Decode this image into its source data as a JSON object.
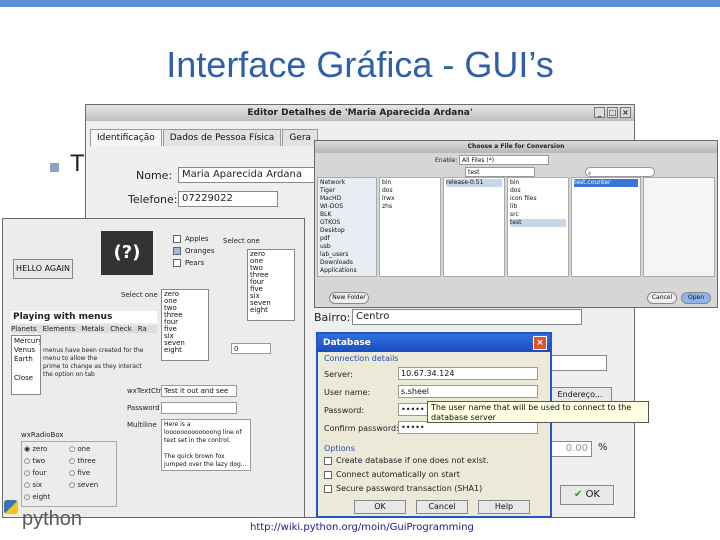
{
  "slide": {
    "title": "Interface Gráfica - GUI’s",
    "bullet": "T"
  },
  "editor": {
    "title": "Editor Detalhes de 'Maria Aparecida Ardana'",
    "tabs": [
      "Identificação",
      "Dados de Pessoa Física",
      "Gera"
    ],
    "name_label": "Nome:",
    "name_value": "Maria Aparecida Ardana",
    "phone_label": "Telefone:",
    "phone_value": "07229022",
    "bairro_label": "Bairro:",
    "bairro_value": "Centro",
    "endereco_btn": "Endereço...",
    "percent": "0.00",
    "percent_sign": "%",
    "ok_label": "OK"
  },
  "chooser": {
    "title": "Choose a File for Conversion",
    "enable_label": "Enable:",
    "enable_value": "All Files (*)",
    "path": "test",
    "sidebar": [
      "Network",
      "Tiger",
      "MacHD",
      "WI-DOS",
      "BLK",
      "GTKOS",
      "Desktop",
      "pdf",
      "usb",
      "lab_users",
      "Downloads",
      "Applications"
    ],
    "col2": [
      "bin",
      "dos",
      "lrwx",
      "zhs"
    ],
    "col3": [
      "release-0.51"
    ],
    "col4": [
      "bin",
      "dos",
      "icon files",
      "lib",
      "src",
      "test"
    ],
    "col5": [
      "test.counter"
    ],
    "new_folder": "New Folder",
    "cancel": "Cancel",
    "open": "Open"
  },
  "widgets": {
    "hello_btn": "HELLO AGAIN",
    "logo": "(?)",
    "checks": [
      "Apples",
      "Oranges",
      "Pears"
    ],
    "select_one": "Select one",
    "select_label": "Select one",
    "list1": [
      "zero",
      "one",
      "two",
      "three",
      "four",
      "five",
      "six",
      "seven",
      "eight"
    ],
    "list2": [
      "zero",
      "one",
      "two",
      "three",
      "four",
      "five",
      "six",
      "seven",
      "eight"
    ],
    "menus_title": "Playing with menus",
    "menu_bar": [
      "Planets",
      "Elements",
      "Metals",
      "Check",
      "Ra"
    ],
    "planets": [
      "Mercury",
      "Venus",
      "Earth",
      "Close"
    ],
    "menu_text": "menus have been created for the\nmenu to allow the\nprime to change as they interact\nthe option on tab",
    "spin_value": "0",
    "textctrl_label": "wxTextCtrl",
    "textctrl_value": "Test it out and see",
    "password_label": "Password",
    "multiline_label": "Multiline",
    "multiline_text": "Here is a looooooooooooong line of text set in the control.\n\nThe quick brown fox jumped over the lazy dog...",
    "radiobox_label": "wxRadioBox",
    "radios": [
      "zero",
      "one",
      "two",
      "three",
      "four",
      "five",
      "six",
      "seven",
      "eight"
    ]
  },
  "db": {
    "title": "Database",
    "group1": "Connection details",
    "server_label": "Server:",
    "server_value": "10.67.34.124",
    "user_label": "User name:",
    "user_value": "s.sheel",
    "password_label": "Password:",
    "password_value": "•••••",
    "confirm_label": "Confirm password:",
    "confirm_value": "•••••",
    "tooltip": "The user name that will be used to connect to the database server",
    "group2": "Options",
    "options": [
      "Create database if one does not exist.",
      "Connect automatically on start",
      "Secure password transaction (SHA1)"
    ],
    "buttons": [
      "OK",
      "Cancel",
      "Help"
    ]
  },
  "footer": {
    "url": "http://wiki.python.org/moin/GuiProgramming",
    "logo": "python"
  }
}
